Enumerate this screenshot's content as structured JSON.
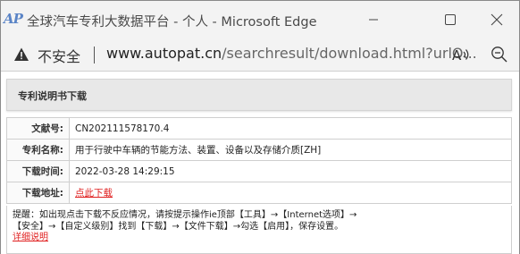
{
  "window": {
    "logo_text": "AP",
    "title": "全球汽车专利大数据平台 - 个人 - Microsoft Edge"
  },
  "address_bar": {
    "security_label": "不安全",
    "url_host": "www.autopat.cn",
    "url_path": "/searchresult/download.html?urlQ..."
  },
  "page": {
    "panel_title": "专利说明书下载",
    "rows": [
      {
        "label": "文献号:",
        "value": "CN202111578170.4"
      },
      {
        "label": "专利名称:",
        "value": "用于行驶中车辆的节能方法、装置、设备以及存储介质[ZH]"
      },
      {
        "label": "下载时间:",
        "value": "2022-03-28 14:29:15"
      },
      {
        "label": "下载地址:",
        "value": "点此下载"
      }
    ],
    "notice_line1": "提醒：如出现点击下载不反应情况，请按提示操作ie顶部【工具】→【Internet选项】→",
    "notice_line2": "【安全】→【自定义级别】找到【下载】→【文件下载】→勾选【启用】，保存设置。",
    "notice_link": "详细说明"
  },
  "colors": {
    "link_red": "#e02020",
    "chrome_bg": "#f3f3f3",
    "logo_blue": "#5a84c6"
  }
}
